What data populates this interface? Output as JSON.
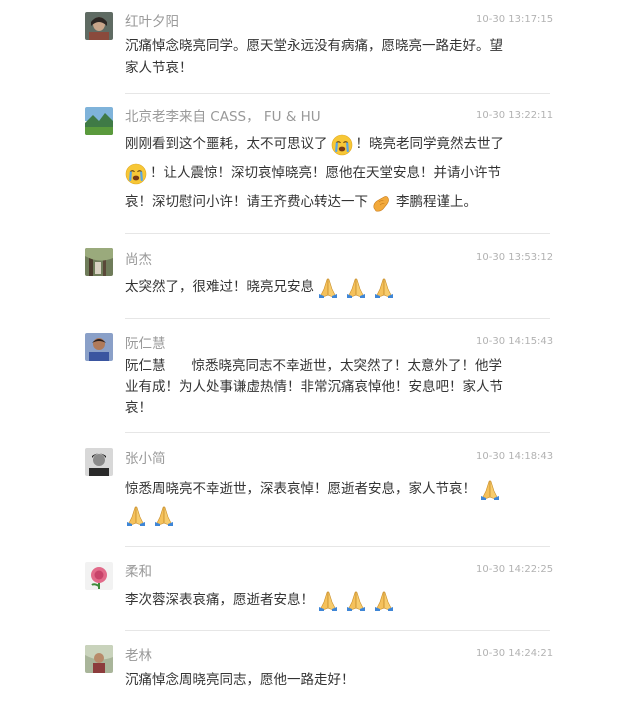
{
  "comments": [
    {
      "author": "红叶夕阳",
      "time": "10-30 13:17:15",
      "avatar_icon": "woman-portrait-avatar",
      "lines": [
        "沉痛悼念晓亮同学。愿天堂永远没有病痛，愿晓亮一路走好。望",
        "家人节哀！"
      ]
    },
    {
      "author": "北京老李来自 CASS，  FU & HU",
      "time": "10-30 13:22:11",
      "avatar_icon": "landscape-avatar",
      "l1a": "刚刚看到这个噩耗，太不可思议了",
      "l1b": "！晓亮老同学竟然去世了",
      "l2": "！让人震惊！深切哀悼晓亮！愿他在天堂安息！并请小许节",
      "l3a": "哀！深切慰问小许！请王齐费心转达一下",
      "l3b": "李鹏程谨上。"
    },
    {
      "author": "尚杰",
      "time": "10-30 13:53:12",
      "avatar_icon": "forest-avatar",
      "text": "太突然了，很难过！晓亮兄安息"
    },
    {
      "author": "阮仁慧",
      "time": "10-30 14:15:43",
      "avatar_icon": "person-avatar",
      "l1a": "阮仁慧",
      "l1b": "惊悉晓亮同志不幸逝世，太突然了！太意外了！他学",
      "l2": "业有成！为人处事谦虚热情！非常沉痛哀悼他！安息吧！家人节",
      "l3": "哀！"
    },
    {
      "author": "张小简",
      "time": "10-30 14:18:43",
      "avatar_icon": "black-white-portrait-avatar",
      "text": "惊悉周晓亮不幸逝世，深表哀悼！愿逝者安息，家人节哀！"
    },
    {
      "author": "柔和",
      "time": "10-30 14:22:25",
      "avatar_icon": "rose-avatar",
      "text": "李次蓉深表哀痛，愿逝者安息！"
    },
    {
      "author": "老林",
      "time": "10-30 14:24:21",
      "avatar_icon": "outdoor-portrait-avatar",
      "text": "沉痛悼念周晓亮同志，愿他一路走好！"
    }
  ],
  "icons": {
    "crying": "crying-face-icon",
    "pray": "praying-hands-icon",
    "fist": "clasped-fist-icon"
  },
  "colors": {
    "author": "#999999",
    "time": "#b2b2b2",
    "text": "#333333",
    "divider": "#e6e6e6"
  }
}
